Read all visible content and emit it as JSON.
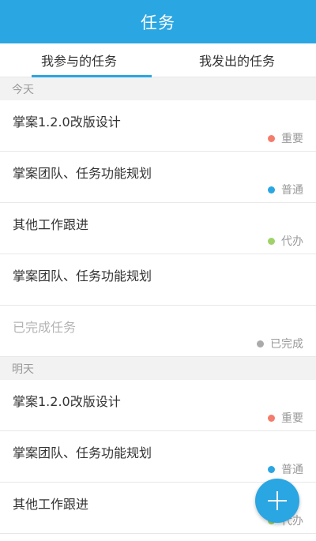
{
  "header": {
    "title": "任务"
  },
  "tabs": [
    {
      "label": "我参与的任务",
      "active": true
    },
    {
      "label": "我发出的任务",
      "active": false
    }
  ],
  "sections": [
    {
      "label": "今天",
      "tasks": [
        {
          "title": "掌案1.2.0改版设计",
          "tag": "重要",
          "tag_color": "#f47c6c",
          "done": false
        },
        {
          "title": "掌案团队、任务功能规划",
          "tag": "普通",
          "tag_color": "#2aa6e2",
          "done": false
        },
        {
          "title": "其他工作跟进",
          "tag": "代办",
          "tag_color": "#9fd36a",
          "done": false
        },
        {
          "title": "掌案团队、任务功能规划",
          "tag": "",
          "tag_color": "",
          "done": false
        },
        {
          "title": "已完成任务",
          "tag": "已完成",
          "tag_color": "#aaaaaa",
          "done": true
        }
      ]
    },
    {
      "label": "明天",
      "tasks": [
        {
          "title": "掌案1.2.0改版设计",
          "tag": "重要",
          "tag_color": "#f47c6c",
          "done": false
        },
        {
          "title": "掌案团队、任务功能规划",
          "tag": "普通",
          "tag_color": "#2aa6e2",
          "done": false
        },
        {
          "title": "其他工作跟进",
          "tag": "代办",
          "tag_color": "#9fd36a",
          "done": false
        }
      ]
    }
  ],
  "fab": {
    "icon": "plus-icon",
    "color": "#2aa6e2"
  },
  "colors": {
    "primary": "#2aa6e2",
    "section_bg": "#f2f2f2"
  }
}
